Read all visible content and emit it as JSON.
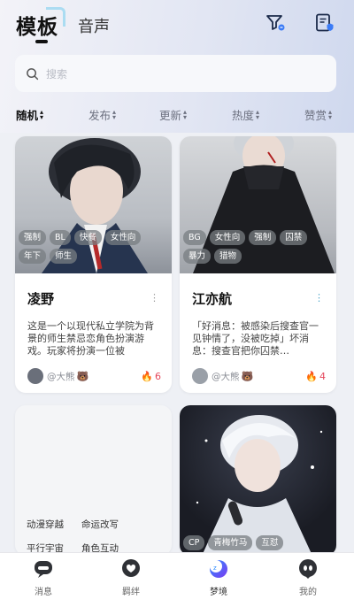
{
  "header": {
    "tab_active": "模板",
    "tab_voice": "音声",
    "icons": [
      "filter-icon",
      "note-badge-icon"
    ]
  },
  "search": {
    "placeholder": "搜索"
  },
  "sort": [
    {
      "label": "随机",
      "active": true
    },
    {
      "label": "发布",
      "active": false
    },
    {
      "label": "更新",
      "active": false
    },
    {
      "label": "热度",
      "active": false
    },
    {
      "label": "赞赏",
      "active": false
    }
  ],
  "cards": [
    {
      "name": "凌野",
      "tags": [
        "强制",
        "BL",
        "快餐",
        "女性向",
        "年下",
        "师生"
      ],
      "desc": "这是一个以现代私立学院为背景的师生禁忌恋角色扮演游戏。玩家将扮演一位被",
      "author": "@大熊",
      "likes": "6"
    },
    {
      "name": "江亦航",
      "tags": [
        "BG",
        "女性向",
        "强制",
        "囚禁",
        "暴力",
        "猎物"
      ],
      "desc": "「好消息：被感染后搜查官一见钟情了，没被吃掉」坏消息：搜查官把你囚禁…",
      "author": "@大熊",
      "likes": "4"
    },
    {
      "plain_tags": [
        "动漫穿越",
        "命运改写",
        "平行宇宙",
        "角色互动"
      ]
    },
    {
      "tags": [
        "CP",
        "青梅竹马",
        "互怼"
      ]
    }
  ],
  "tabbar": [
    {
      "label": "消息",
      "icon": "message-icon",
      "active": false
    },
    {
      "label": "羁绊",
      "icon": "bond-icon",
      "active": false
    },
    {
      "label": "梦境",
      "icon": "dream-icon",
      "active": true
    },
    {
      "label": "我的",
      "icon": "profile-icon",
      "active": false
    }
  ],
  "colors": {
    "accent": "#4a6cf7",
    "like": "#e5485c",
    "text": "#111111"
  }
}
